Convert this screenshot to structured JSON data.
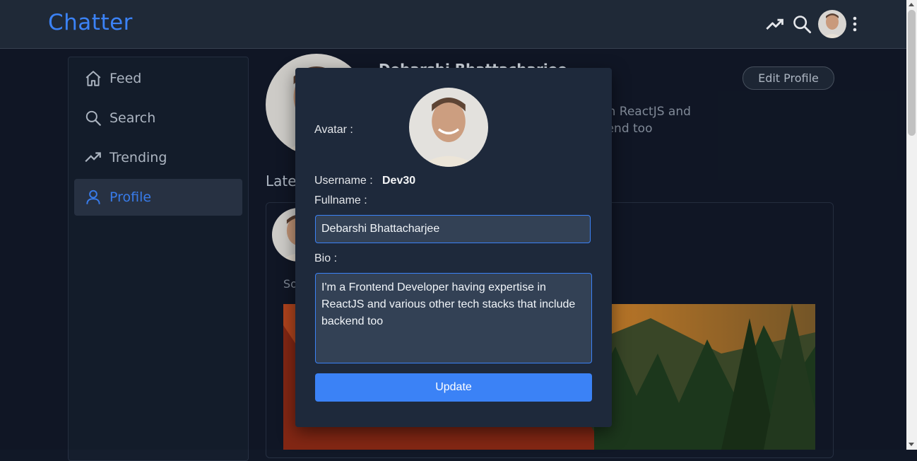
{
  "app": {
    "brand": "Chatter"
  },
  "colors": {
    "accent": "#3b82f6",
    "background": "#111827",
    "panel": "#1f2937",
    "modal": "#1e293b"
  },
  "topbar": {
    "icons": [
      "trending-icon",
      "search-icon",
      "avatar",
      "more-vertical-icon"
    ]
  },
  "sidebar": {
    "items": [
      {
        "label": "Feed",
        "icon": "home-icon"
      },
      {
        "label": "Search",
        "icon": "search-icon"
      },
      {
        "label": "Trending",
        "icon": "trending-icon"
      },
      {
        "label": "Profile",
        "icon": "user-icon",
        "active": true
      }
    ]
  },
  "profile": {
    "name_partial": "Debarshi Bhattacharjee",
    "bio_line1": "e in ReactJS and",
    "bio_line2": "ckend too",
    "edit_label": "Edit Profile",
    "latest_label": "Late",
    "post_text": "So"
  },
  "modal": {
    "avatar_label": "Avatar :",
    "username_label": "Username :",
    "username_value": "Dev30",
    "fullname_label": "Fullname :",
    "fullname_value": "Debarshi Bhattacharjee",
    "bio_label": "Bio :",
    "bio_value": "I'm a Frontend Developer having expertise in ReactJS and various other tech stacks that include backend too",
    "update_label": "Update"
  }
}
